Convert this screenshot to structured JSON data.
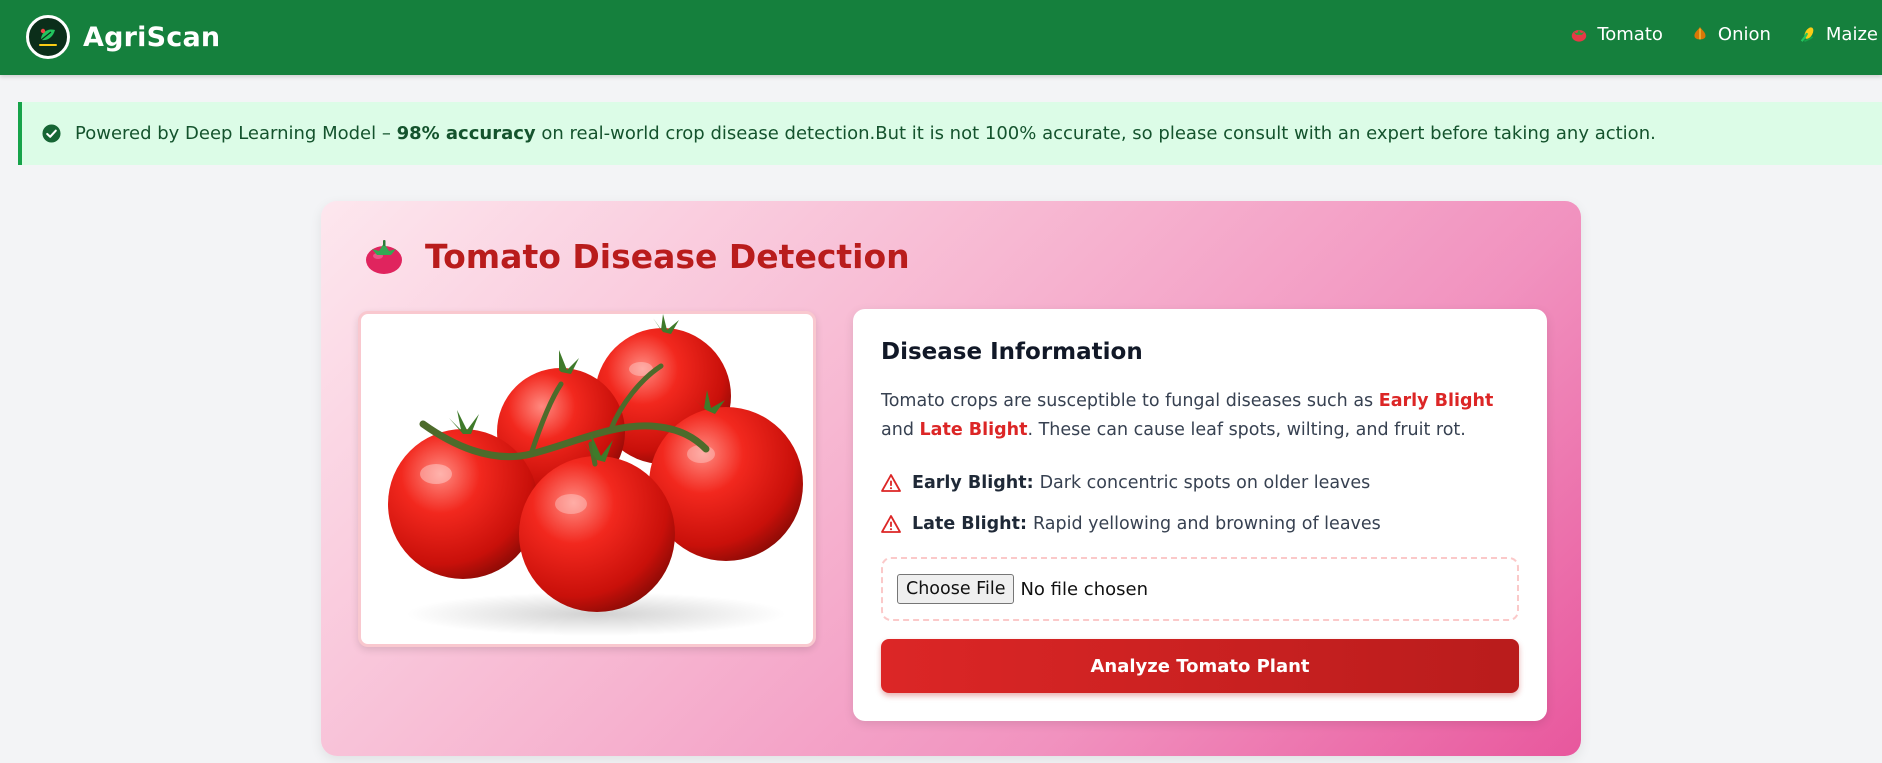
{
  "navbar": {
    "brand": "AgriScan",
    "links": [
      {
        "label": "Tomato",
        "icon": "tomato-icon"
      },
      {
        "label": "Onion",
        "icon": "onion-icon"
      },
      {
        "label": "Maize",
        "icon": "maize-icon"
      }
    ]
  },
  "notice": {
    "icon": "check-circle-icon",
    "prefix": "Powered by Deep Learning Model – ",
    "highlight": "98% accuracy",
    "suffix": " on real-world crop disease detection.But it is not 100% accurate, so please consult with an expert before taking any action."
  },
  "card": {
    "title": "Tomato Disease Detection",
    "title_icon": "tomato-icon",
    "image_subject": "tomato-vine-image",
    "info": {
      "heading": "Disease Information",
      "desc_part1": "Tomato crops are susceptible to fungal diseases such as ",
      "desc_hl1": "Early Blight",
      "desc_part2": " and ",
      "desc_hl2": "Late Blight",
      "desc_part3": ". These can cause leaf spots, wilting, and fruit rot.",
      "diseases": [
        {
          "name": "Early Blight:",
          "description": "Dark concentric spots on older leaves",
          "icon": "warning-icon"
        },
        {
          "name": "Late Blight:",
          "description": "Rapid yellowing and browning of leaves",
          "icon": "warning-icon"
        }
      ],
      "file_button": "Choose File",
      "file_status": "No file chosen",
      "analyze_button": "Analyze Tomato Plant"
    }
  },
  "colors": {
    "nav_bg": "#15803d",
    "notice_bg": "#dcfce7",
    "notice_border": "#16a34a",
    "title_red": "#b91c1c",
    "highlight_red": "#dc2626",
    "button_red": "#dc2626"
  }
}
